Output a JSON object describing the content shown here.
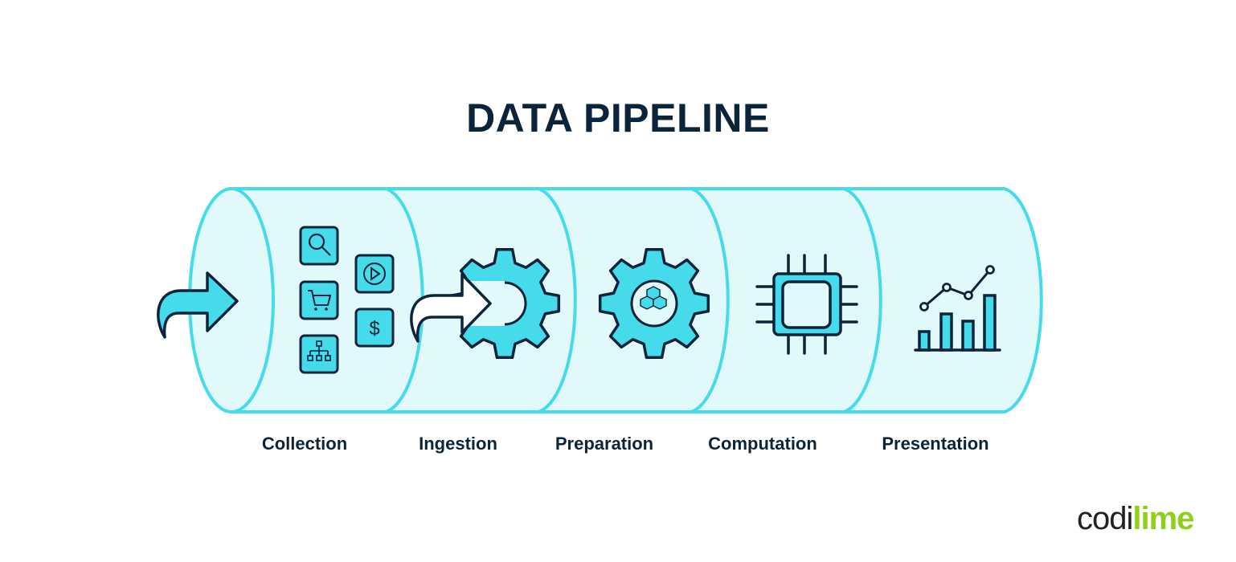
{
  "title": "DATA PIPELINE",
  "stages": [
    {
      "label": "Collection",
      "icon": "data-sources-icon"
    },
    {
      "label": "Ingestion",
      "icon": "gear-intake-icon"
    },
    {
      "label": "Preparation",
      "icon": "gear-cubes-icon"
    },
    {
      "label": "Computation",
      "icon": "cpu-chip-icon"
    },
    {
      "label": "Presentation",
      "icon": "chart-icon"
    }
  ],
  "collection_sources": [
    "search-icon",
    "video-play-icon",
    "cart-icon",
    "dollar-icon",
    "hierarchy-icon"
  ],
  "colors": {
    "accent": "#46dbeb",
    "fill": "#e1f9fb",
    "outline": "#0b2439",
    "brand_green": "#8ed11c"
  },
  "logo": {
    "part1": "codi",
    "part2": "lime"
  }
}
